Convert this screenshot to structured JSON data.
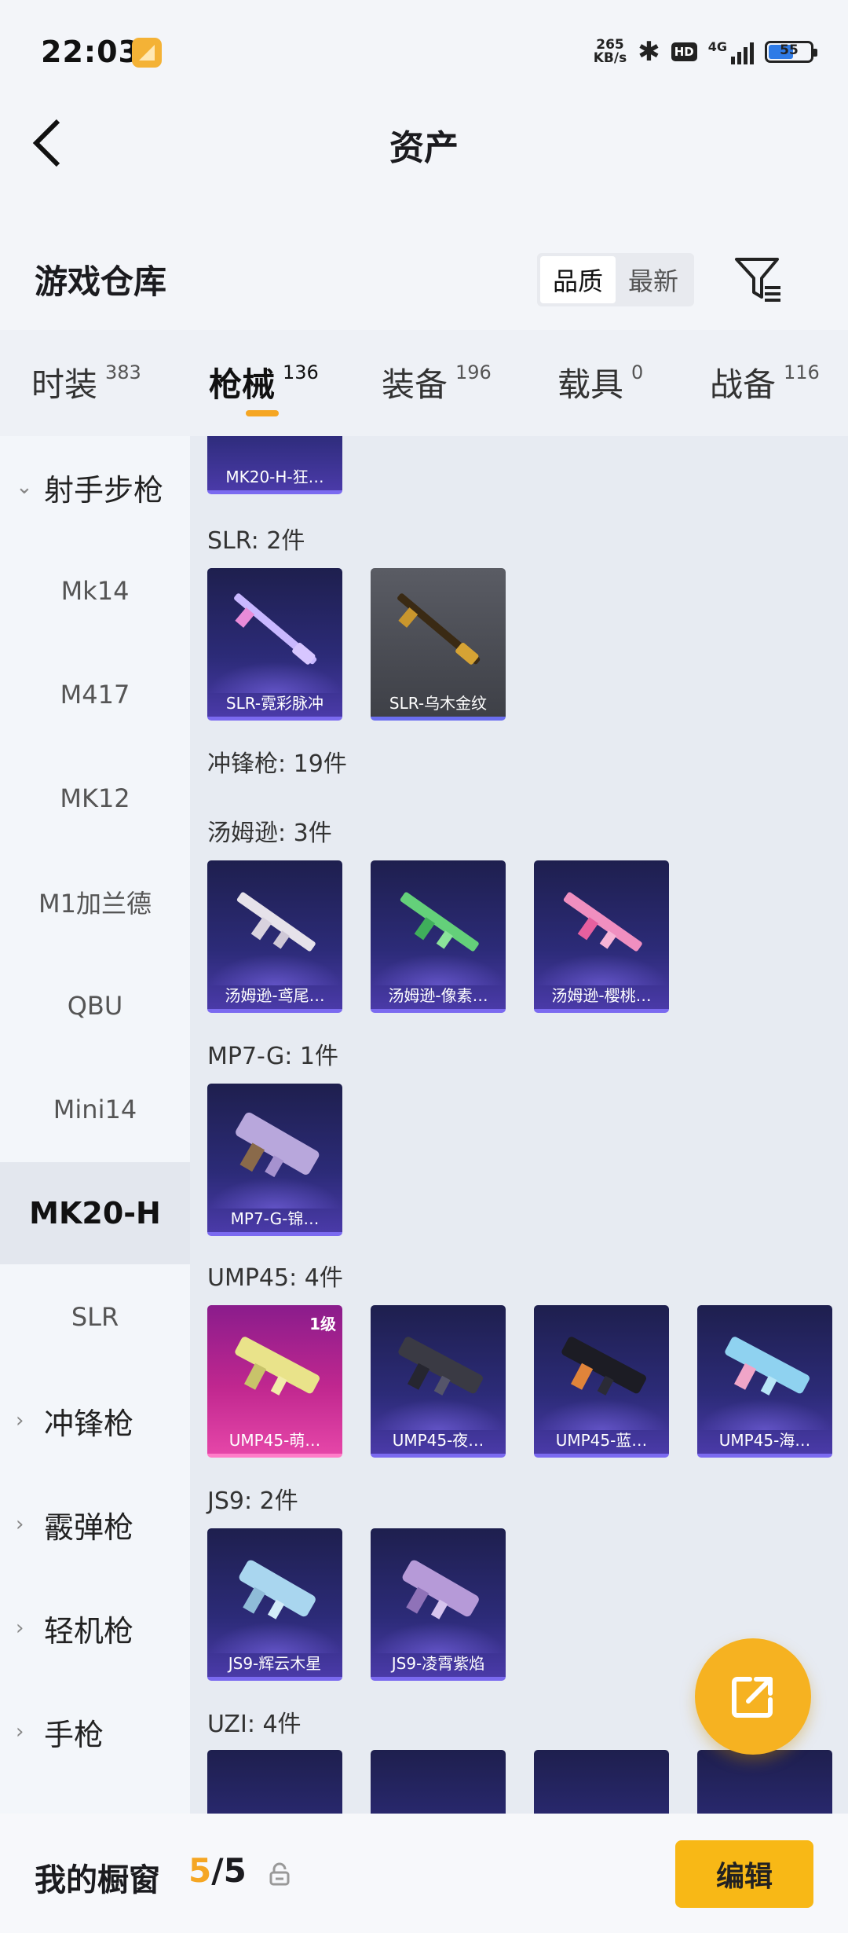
{
  "status": {
    "time": "22:03",
    "net_speed_value": "265",
    "net_speed_unit": "KB/s",
    "hd": "HD",
    "network": "4G",
    "battery": "55"
  },
  "header": {
    "title": "资产"
  },
  "warehouse": {
    "title": "游戏仓库",
    "sort_quality": "品质",
    "sort_newest": "最新"
  },
  "tabs": [
    {
      "label": "时装",
      "count": "383"
    },
    {
      "label": "枪械",
      "count": "136"
    },
    {
      "label": "装备",
      "count": "196"
    },
    {
      "label": "载具",
      "count": "0"
    },
    {
      "label": "战备",
      "count": "116"
    }
  ],
  "sidebar": {
    "items": [
      "射手步枪",
      "Mk14",
      "M417",
      "MK12",
      "M1加兰德",
      "QBU",
      "Mini14",
      "MK20-H",
      "SLR",
      "冲锋枪",
      "霰弹枪",
      "轻机枪",
      "手枪"
    ]
  },
  "content": {
    "partial_card": "MK20-H-狂…",
    "slr": {
      "label": "SLR: 2件",
      "cards": [
        "SLR-霓彩脉冲",
        "SLR-乌木金纹"
      ]
    },
    "smg_label": "冲锋枪: 19件",
    "thompson": {
      "label": "汤姆逊: 3件",
      "cards": [
        "汤姆逊-鸢尾…",
        "汤姆逊-像素…",
        "汤姆逊-樱桃…"
      ]
    },
    "mp7": {
      "label": "MP7-G: 1件",
      "cards": [
        "MP7-G-锦…"
      ]
    },
    "ump45": {
      "label": "UMP45: 4件",
      "level": "1级",
      "cards": [
        "UMP45-萌…",
        "UMP45-夜…",
        "UMP45-蓝…",
        "UMP45-海…"
      ]
    },
    "js9": {
      "label": "JS9: 2件",
      "cards": [
        "JS9-辉云木星",
        "JS9-凌霄紫焰"
      ]
    },
    "uzi": {
      "label": "UZI: 4件"
    }
  },
  "bottom": {
    "showcase_label": "我的橱窗",
    "count_current": "5",
    "count_total": "/5",
    "edit_label": "编辑"
  },
  "icons": [
    "back-arrow-icon",
    "filter-icon",
    "share-export-icon",
    "lock-icon",
    "bluetooth-icon",
    "signal-icon",
    "battery-icon"
  ]
}
